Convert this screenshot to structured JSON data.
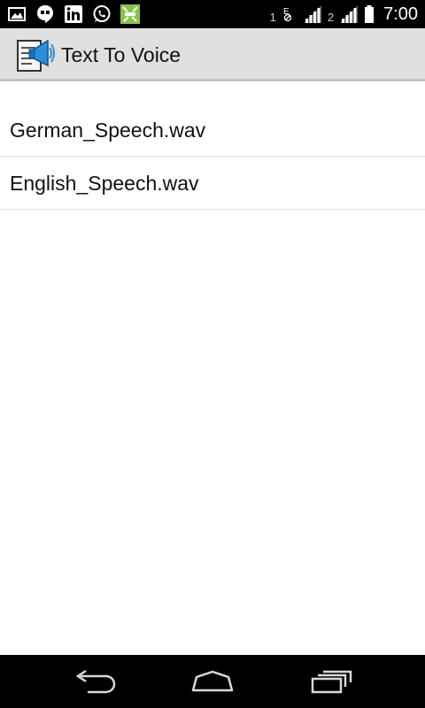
{
  "status_bar": {
    "sim1_label": "1",
    "sim2_label": "2",
    "time": "7:00",
    "notification_icons": [
      "gallery-icon",
      "hangouts-icon",
      "linkedin-icon",
      "whatsapp-icon",
      "android-icon"
    ]
  },
  "app_bar": {
    "title": "Text To Voice",
    "icon": "megaphone-document-icon"
  },
  "files": [
    {
      "name": "German_Speech.wav"
    },
    {
      "name": "English_Speech.wav"
    }
  ],
  "colors": {
    "status_bar": "#000000",
    "action_bar": "#e0e0e0",
    "list_divider": "#e2e2e2",
    "android_green": "#8bc34a"
  }
}
